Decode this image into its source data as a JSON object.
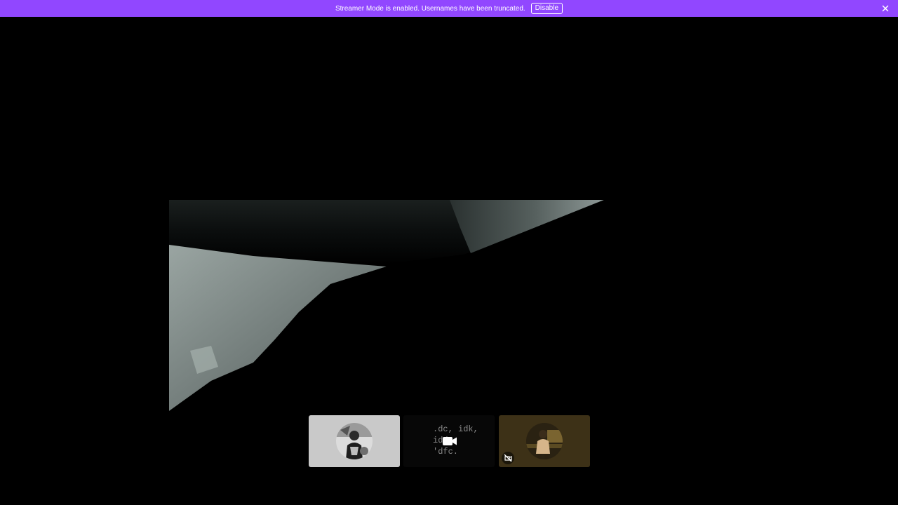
{
  "banner": {
    "message": "Streamer Mode is enabled. Usernames have been truncated.",
    "disable_label": "Disable",
    "close_icon": "close-icon",
    "background_color": "#9147ff"
  },
  "stage": {
    "background_color": "#000000"
  },
  "participants": [
    {
      "id": "participant-1",
      "avatar": "avatar-monochrome-person",
      "background_color": "#c9c9c9"
    },
    {
      "id": "participant-2",
      "screen_text": ".dc, idk,\nidd\n'dfc.",
      "icon": "video-camera-icon",
      "background_color": "#070707"
    },
    {
      "id": "participant-3",
      "avatar": "avatar-warm-person",
      "status_icon": "video-off-icon",
      "background_color": "#3d3117"
    }
  ]
}
